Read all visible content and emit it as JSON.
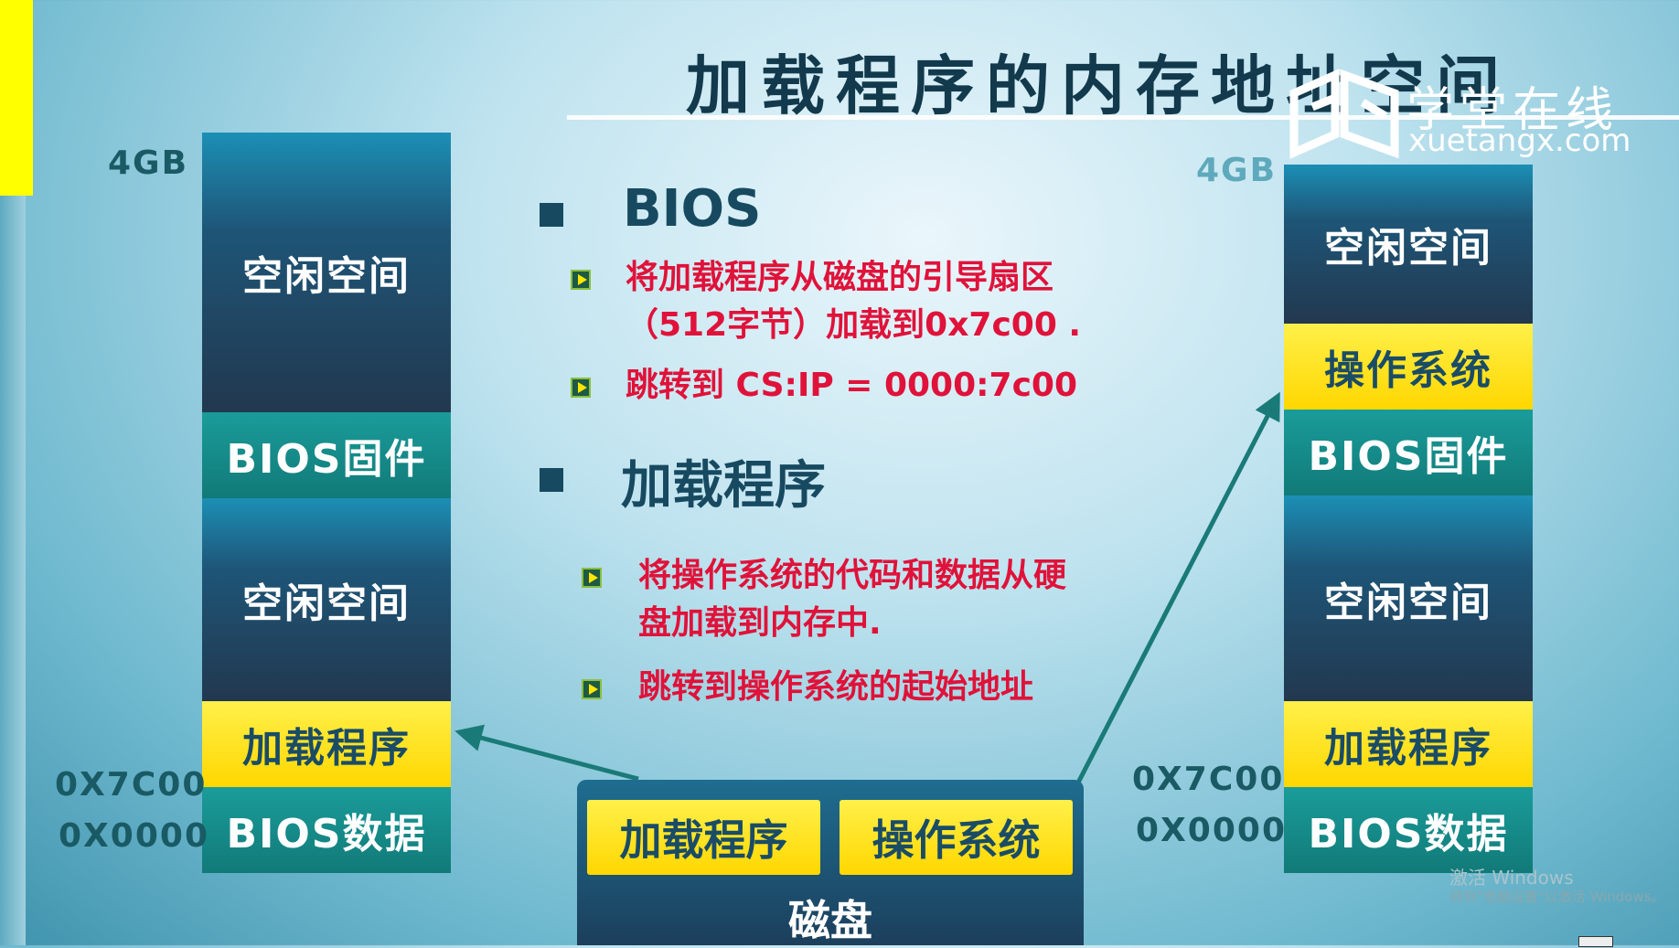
{
  "slide": {
    "title": "加载程序的内存地址空间",
    "logo": {
      "name": "学堂在线",
      "url": "xuetangx.com"
    }
  },
  "left_memory": {
    "top_label": "4GB",
    "blocks": [
      "空闲空间",
      "BIOS固件",
      "空闲空间",
      "加载程序",
      "BIOS数据"
    ],
    "addr_7c00": "0X7C00",
    "addr_0000": "0X0000"
  },
  "right_memory": {
    "top_label": "4GB",
    "blocks": [
      "空闲空间",
      "操作系统",
      "BIOS固件",
      "空闲空间",
      "加载程序",
      "BIOS数据"
    ],
    "addr_7c00": "0X7C00",
    "addr_0000": "0X0000"
  },
  "bios_section": {
    "heading": "BIOS",
    "item1_line1": "将加载程序从磁盘的引导扇区",
    "item1_line2": "（512字节）加载到0x7c00 .",
    "item2": "跳转到 CS:IP = 0000:7c00"
  },
  "loader_section": {
    "heading": "加载程序",
    "item1_line1": "将操作系统的代码和数据从硬",
    "item1_line2": "盘加载到内存中.",
    "item2": "跳转到操作系统的起始地址"
  },
  "disk": {
    "loader": "加载程序",
    "os": "操作系统",
    "label": "磁盘"
  },
  "watermark": {
    "line1": "激活 Windows",
    "line2": "转到\"电脑设置\"以激活 Windows。"
  },
  "colors": {
    "accent_red": "#e0123a",
    "dark_teal": "#174a60",
    "yellow": "#ffd700"
  }
}
